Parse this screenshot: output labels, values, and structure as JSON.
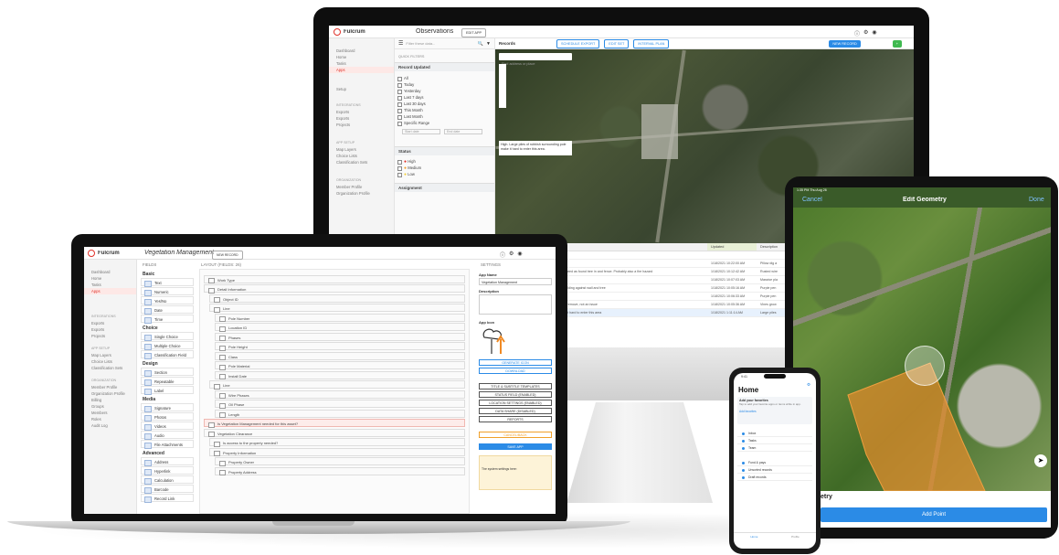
{
  "colors": {
    "brand": "#e0332b",
    "accent": "#2b8be6",
    "success": "#3fb950",
    "warning": "#f0a02a"
  },
  "monitor": {
    "app_name": "Fulcrum",
    "view_title": "Observations",
    "edit_app": "EDIT APP",
    "search_placeholder": "Filter these data...",
    "records_label": "Records",
    "toolbar_buttons": [
      "SCHEDULE EXPORT",
      "EDIT SET",
      "INTERVAL PLAN"
    ],
    "new_record": "NEW RECORD",
    "map_search_placeholder": "Find address or place",
    "map_popup": "High. Large piles of rubbish surrounding pole make it hard to enter this area.",
    "sidebar": {
      "items": [
        "Dashboard",
        "Home",
        "Tasks",
        "Apps"
      ],
      "active_index": 3,
      "collapse_label": "Setup",
      "sections": [
        {
          "title": "INTEGRATIONS",
          "items": [
            "Exports",
            "Exports",
            "Projects"
          ]
        },
        {
          "title": "APP SETUP",
          "items": [
            "Map Layers",
            "Choice Lists",
            "Classification Sets"
          ]
        },
        {
          "title": "ORGANIZATION",
          "items": [
            "Member Profile",
            "Organization Profile"
          ]
        }
      ]
    },
    "quick_filters": "QUICK FILTERS",
    "filter_groups": [
      {
        "title": "Record Updated",
        "options": [
          "All",
          "Today",
          "Yesterday",
          "Last 7 days",
          "Last 30 days",
          "This Month",
          "Last Month",
          "Specific Range"
        ]
      },
      {
        "title": "Status",
        "options": [
          "High",
          "Medium",
          "Low"
        ]
      },
      {
        "title": "Assignment",
        "options": []
      }
    ],
    "range_placeholders": [
      "Start date",
      "End date"
    ],
    "grid": {
      "columns": [
        "Status",
        "Title",
        "Updated",
        "Description"
      ],
      "rows": [
        {
          "title": "",
          "updated": "",
          "description": ""
        },
        {
          "title": "and clearance",
          "updated": "1/18/2021 10:22:00 AM",
          "description": "Pillow dig a"
        },
        {
          "title": "shed or rubbish lease navigated as found tree in and fence. Probably also a fire hazard",
          "updated": "1/18/2021 10:12:42 AM",
          "description": "Rusted wire"
        },
        {
          "title": "",
          "updated": "1/18/2021 10:07:03 AM",
          "description": "Massive pla"
        },
        {
          "title": "and blocking access to a building against wall and tree",
          "updated": "1/18/2021 10:05:16 AM",
          "description": "Purple pen"
        },
        {
          "title": "surrounding pole",
          "updated": "1/18/2021 10:06:33 AM",
          "description": "Purple pen"
        },
        {
          "title": "ling onto powerline, easy to remove, not an issue",
          "updated": "1/18/2021 10:05:36 AM",
          "description": "Vines grow"
        },
        {
          "title": "ges surrounding pole make it hard to enter this area",
          "updated": "1/18/2021 1:11:14 AM",
          "description": "Large piles"
        }
      ]
    }
  },
  "laptop": {
    "app_name": "Fulcrum",
    "view_title": "Vegetation Management",
    "status": "NEW RECORD",
    "fields_header": "FIELDS",
    "layout_header": "LAYOUT (FIELDS: 26)",
    "settings_header": "SETTINGS",
    "sidebar_items": [
      "Dashboard",
      "Home",
      "Tasks",
      "Apps"
    ],
    "sidebar_sections": [
      {
        "title": "INTEGRATIONS",
        "items": [
          "Exports",
          "Exports",
          "Projects"
        ]
      },
      {
        "title": "APP SETUP",
        "items": [
          "Map Layers",
          "Choice Lists",
          "Classification Sets"
        ]
      },
      {
        "title": "ORGANIZATION",
        "items": [
          "Member Profile",
          "Organization Profile",
          "Billing",
          "Groups",
          "Members",
          "Roles",
          "Audit Log"
        ]
      }
    ],
    "tool_groups": [
      {
        "name": "Basic",
        "tools": [
          "Text",
          "Numeric",
          "Yes/No",
          "Date",
          "Time"
        ]
      },
      {
        "name": "Choice",
        "tools": [
          "Single Choice",
          "Multiple Choice",
          "Classification Field"
        ]
      },
      {
        "name": "Design",
        "tools": [
          "Section",
          "Repeatable",
          "Label"
        ]
      },
      {
        "name": "Media",
        "tools": [
          "Signature",
          "Photos",
          "Videos",
          "Audio",
          "File Attachments"
        ]
      },
      {
        "name": "Advanced",
        "tools": [
          "Address",
          "Hyperlink",
          "Calculation",
          "Barcode",
          "Record Link"
        ]
      }
    ],
    "layout_fields": [
      "Work Type",
      "Detail Information",
      "Object ID",
      "Line",
      "Pole Number",
      "Location ID",
      "Phases",
      "Pole Height",
      "Class",
      "Pole Material",
      "Install Date",
      "Line",
      "Wire Phases",
      "Oil Phase",
      "Length",
      "Is Vegetation Management needed for this asset?",
      "Vegetation Clearance",
      "Is access to the property needed?",
      "Property Information",
      "Property Owner",
      "Property Address"
    ],
    "settings": {
      "app_name_label": "App Name",
      "app_name_value": "Vegetation Management",
      "description_label": "Description",
      "app_icon_label": "App Icon",
      "buttons": [
        "GENERATE ICON",
        "DOWNLOAD",
        "TITLE & SUBTITLE TEMPLATES",
        "STATUS FIELD (ENABLED)",
        "LOCATION SETTINGS (ENABLED)",
        "DATA SHARE (DISABLED)",
        "REPORTS"
      ],
      "cancel": "CANCEL/BACK",
      "save": "SAVE APP",
      "note_title": "The system settings here:"
    }
  },
  "tablet": {
    "status_time": "1:35 PM  Thu Aug 26",
    "cancel": "Cancel",
    "title": "Edit Geometry",
    "done": "Done",
    "partial_label": "etry",
    "add_point": "Add Point"
  },
  "phone": {
    "status_time": "9:41",
    "title": "Home",
    "subtitle": "Add your favorites",
    "description": "Tap to add your favorite apps or items while in app.",
    "link": "Add favorites",
    "nav_rows": [
      "Inbox",
      "Tasks",
      "Team"
    ],
    "section_rows": [
      "Fund & pays",
      "Unsorted records",
      "Draft records"
    ],
    "tabs": [
      "Home",
      "Profile"
    ]
  }
}
